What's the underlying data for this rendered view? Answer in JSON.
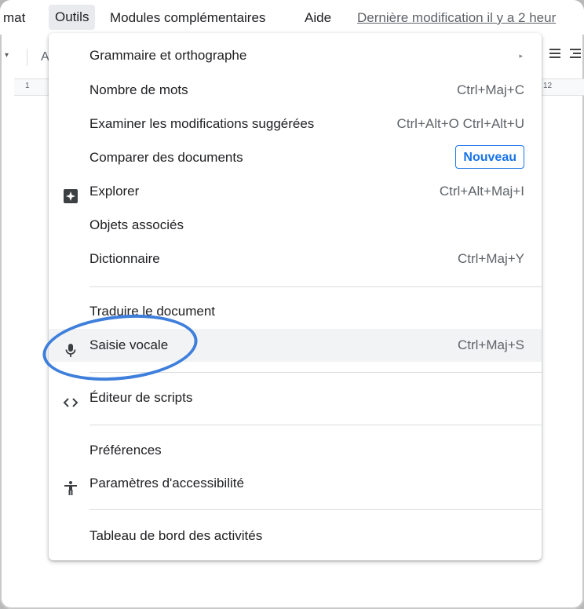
{
  "menubar": {
    "format": "mat",
    "outils": "Outils",
    "modules": "Modules complémentaires",
    "aide": "Aide",
    "last_edit": "Dernière modification il y a 2 heur"
  },
  "toolbar": {
    "font_glyph": "A"
  },
  "ruler": {
    "left_mark": "1",
    "right_mark": "12"
  },
  "menu": {
    "items": [
      {
        "label": "Grammaire et orthographe",
        "arrow": "▸"
      },
      {
        "label": "Nombre de mots",
        "shortcut": "Ctrl+Maj+C"
      },
      {
        "label": "Examiner les modifications suggérées",
        "shortcut": "Ctrl+Alt+O Ctrl+Alt+U"
      },
      {
        "label": "Comparer des documents",
        "badge": "Nouveau"
      },
      {
        "label": "Explorer",
        "shortcut": "Ctrl+Alt+Maj+I",
        "icon": "explore-icon"
      },
      {
        "label": "Objets associés"
      },
      {
        "label": "Dictionnaire",
        "shortcut": "Ctrl+Maj+Y"
      },
      {
        "label": "Traduire le document"
      },
      {
        "label": "Saisie vocale",
        "shortcut": "Ctrl+Maj+S",
        "icon": "microphone-icon",
        "highlighted": true
      },
      {
        "label": "Éditeur de scripts",
        "icon": "code-icon"
      },
      {
        "label": "Préférences"
      },
      {
        "label": "Paramètres d'accessibilité",
        "icon": "accessibility-icon"
      },
      {
        "label": "Tableau de bord des activités"
      }
    ]
  },
  "colors": {
    "accent": "#1a73e8",
    "callout": "#3f7fdc",
    "highlight": "#f1f3f4"
  }
}
